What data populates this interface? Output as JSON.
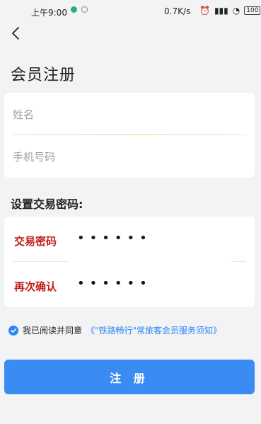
{
  "status": {
    "time": "上午9:00",
    "speed": "0.7K/s",
    "battery": "100"
  },
  "header": {
    "title": "会员注册"
  },
  "form": {
    "name_placeholder": "姓名",
    "phone_placeholder": "手机号码"
  },
  "password_section": {
    "title": "设置交易密码:",
    "password_label": "交易密码",
    "password_value": "••••••",
    "confirm_label": "再次确认",
    "confirm_value": "••••••"
  },
  "agreement": {
    "prefix": "我已阅读并同意",
    "link_text": "《\"铁路畅行\"常旅客会员服务须知》"
  },
  "submit_label": "注 册",
  "colors": {
    "accent": "#3a8cf3",
    "label_red": "#c21f1f"
  },
  "icons": {
    "back": "chevron-left-icon",
    "check": "check-circle-icon"
  }
}
